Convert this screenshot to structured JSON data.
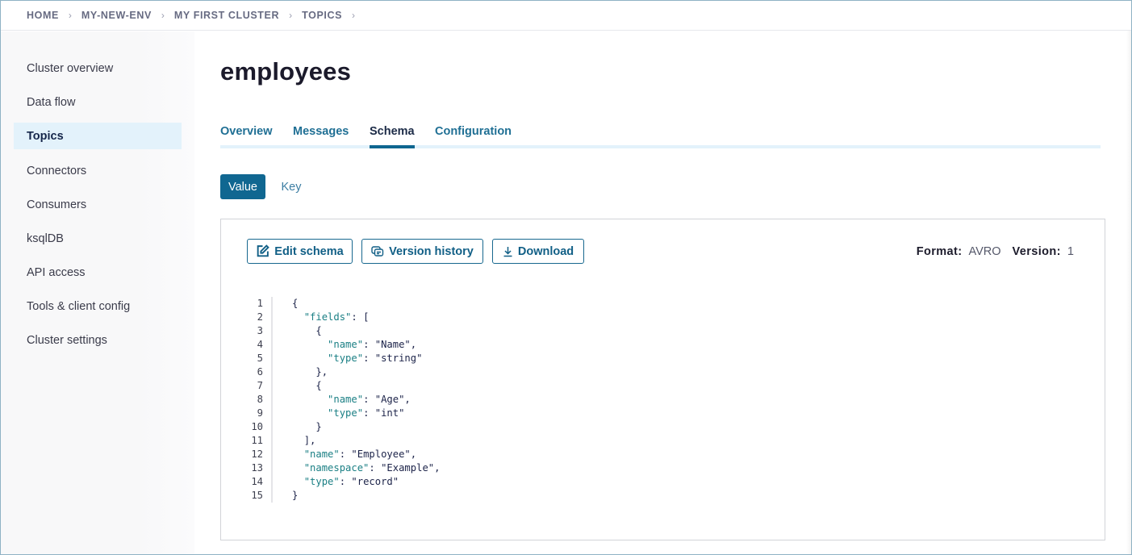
{
  "breadcrumb": [
    "HOME",
    "MY-NEW-ENV",
    "MY FIRST CLUSTER",
    "TOPICS"
  ],
  "breadcrumb_separator": "›",
  "sidebar": {
    "items": [
      {
        "label": "Cluster overview",
        "active": false
      },
      {
        "label": "Data flow",
        "active": false
      },
      {
        "label": "Topics",
        "active": true
      },
      {
        "label": "Connectors",
        "active": false
      },
      {
        "label": "Consumers",
        "active": false
      },
      {
        "label": "ksqlDB",
        "active": false
      },
      {
        "label": "API access",
        "active": false
      },
      {
        "label": "Tools & client config",
        "active": false
      },
      {
        "label": "Cluster settings",
        "active": false
      }
    ]
  },
  "page": {
    "title": "employees",
    "tabs": [
      {
        "label": "Overview",
        "active": false
      },
      {
        "label": "Messages",
        "active": false
      },
      {
        "label": "Schema",
        "active": true
      },
      {
        "label": "Configuration",
        "active": false
      }
    ],
    "segments": [
      {
        "label": "Value",
        "active": true
      },
      {
        "label": "Key",
        "active": false
      }
    ]
  },
  "schema_panel": {
    "buttons": {
      "edit": {
        "label": "Edit schema",
        "icon": "edit-icon"
      },
      "history": {
        "label": "Version history",
        "icon": "version-history-icon"
      },
      "download": {
        "label": "Download",
        "icon": "download-icon"
      }
    },
    "format_label": "Format:",
    "format_value": "AVRO",
    "version_label": "Version:",
    "version_value": "1",
    "code_lines": [
      {
        "num": "1",
        "indent": "",
        "key": "",
        "rest": "{"
      },
      {
        "num": "2",
        "indent": "  ",
        "key": "\"fields\"",
        "rest": ": ["
      },
      {
        "num": "3",
        "indent": "    ",
        "key": "",
        "rest": "{"
      },
      {
        "num": "4",
        "indent": "      ",
        "key": "\"name\"",
        "rest": ": \"Name\","
      },
      {
        "num": "5",
        "indent": "      ",
        "key": "\"type\"",
        "rest": ": \"string\""
      },
      {
        "num": "6",
        "indent": "    ",
        "key": "",
        "rest": "},"
      },
      {
        "num": "7",
        "indent": "    ",
        "key": "",
        "rest": "{"
      },
      {
        "num": "8",
        "indent": "      ",
        "key": "\"name\"",
        "rest": ": \"Age\","
      },
      {
        "num": "9",
        "indent": "      ",
        "key": "\"type\"",
        "rest": ": \"int\""
      },
      {
        "num": "10",
        "indent": "    ",
        "key": "",
        "rest": "}"
      },
      {
        "num": "11",
        "indent": "  ",
        "key": "",
        "rest": "],"
      },
      {
        "num": "12",
        "indent": "  ",
        "key": "\"name\"",
        "rest": ": \"Employee\","
      },
      {
        "num": "13",
        "indent": "  ",
        "key": "\"namespace\"",
        "rest": ": \"Example\","
      },
      {
        "num": "14",
        "indent": "  ",
        "key": "\"type\"",
        "rest": ": \"record\""
      },
      {
        "num": "15",
        "indent": "",
        "key": "",
        "rest": "}"
      }
    ]
  },
  "colors": {
    "accent": "#106791",
    "active_nav_bg": "#e3f2fb",
    "link": "#1f6f94",
    "json_key": "#1a7f84"
  }
}
